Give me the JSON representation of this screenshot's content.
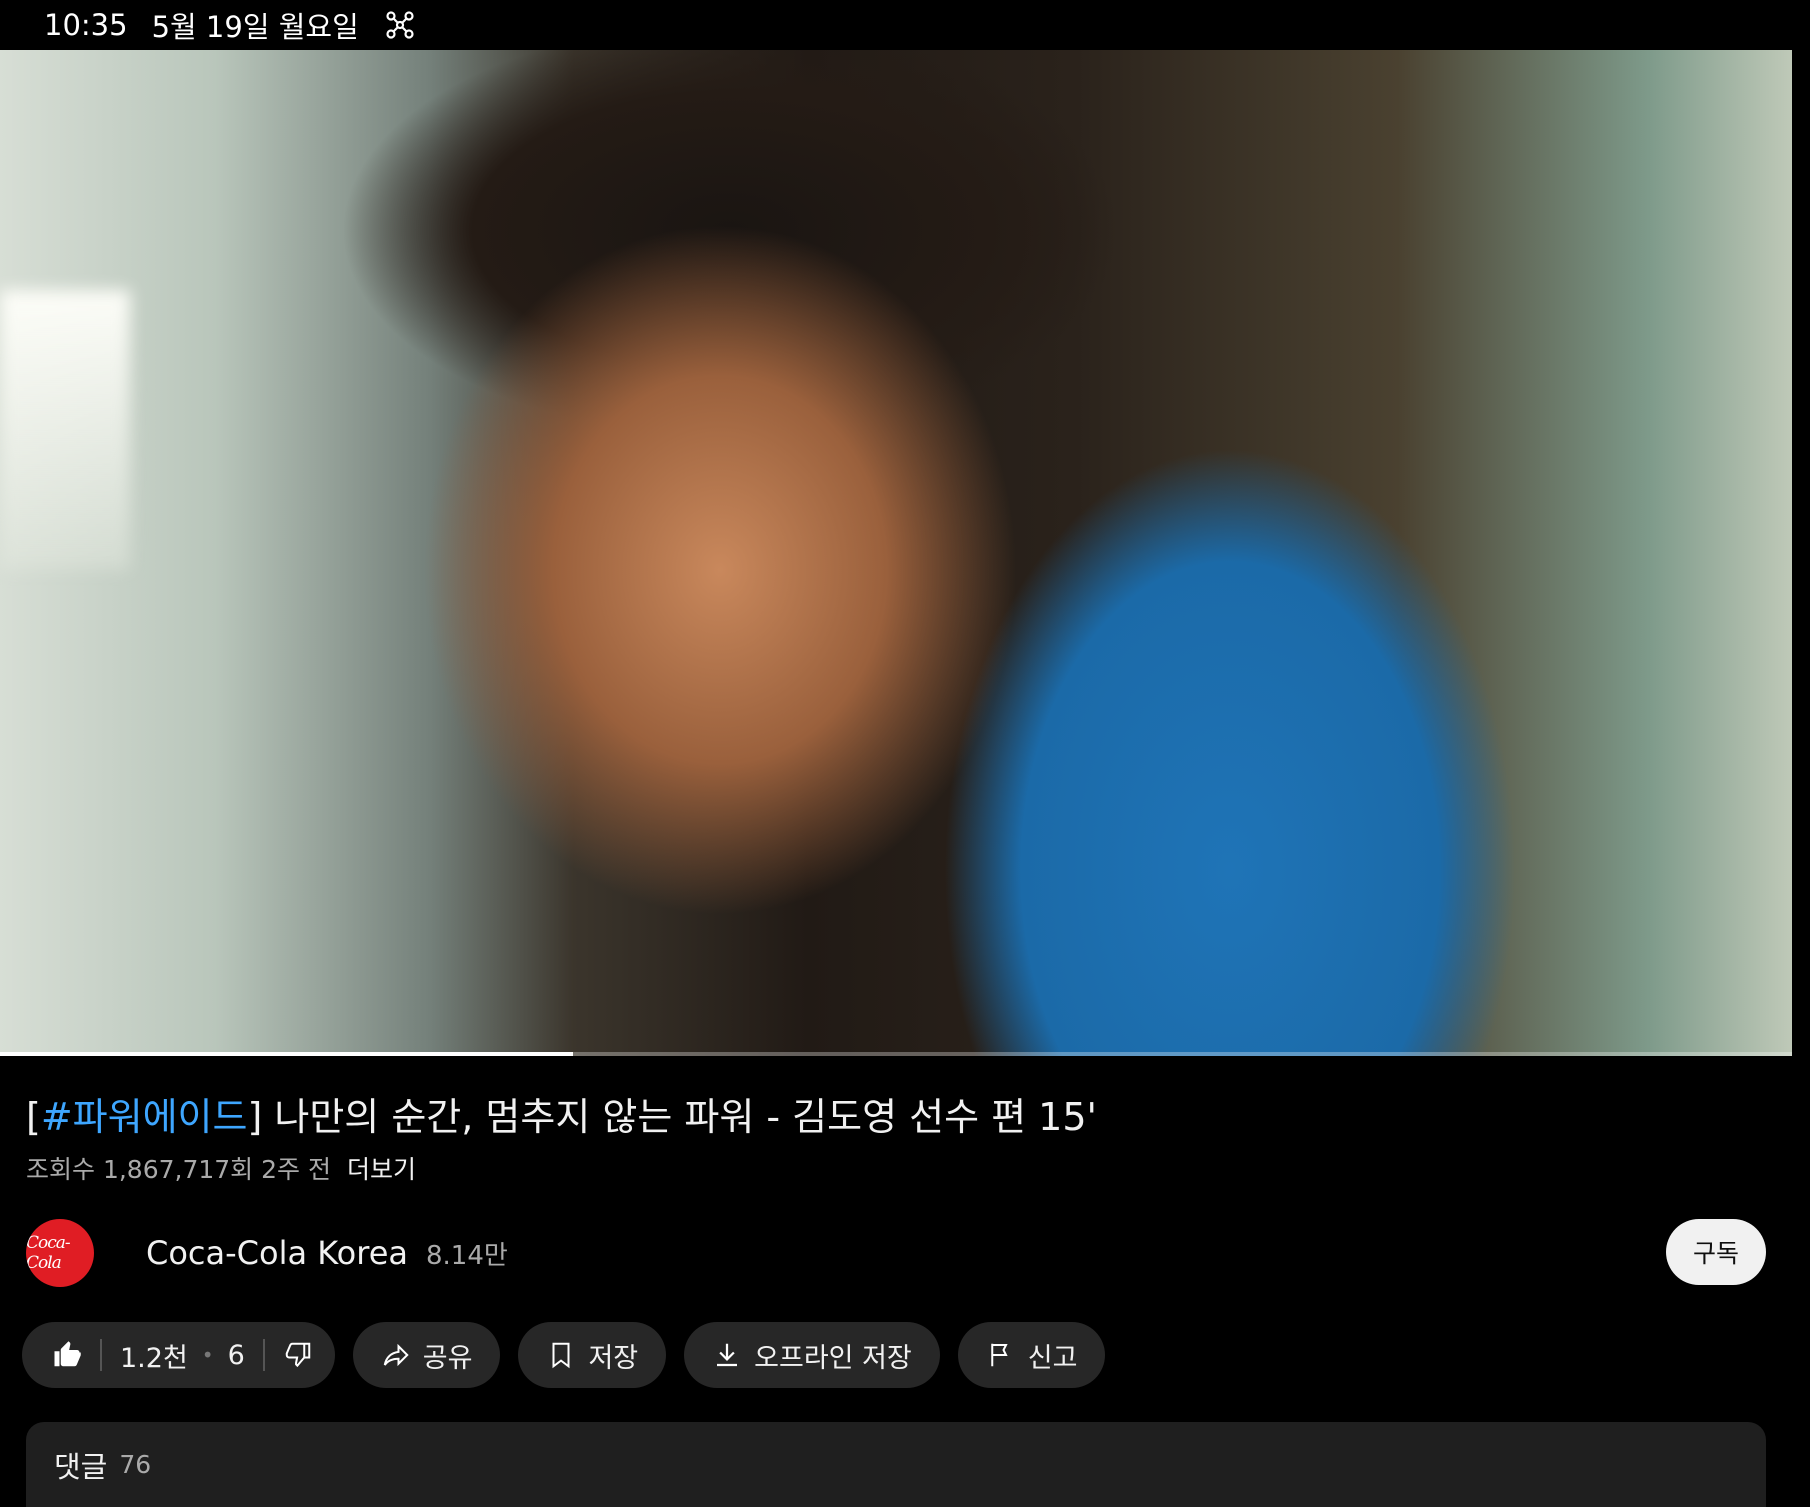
{
  "status_bar": {
    "time": "10:35",
    "date": "5월 19일 월요일",
    "icon": "network-icon"
  },
  "video": {
    "progress_fraction": 0.32
  },
  "title": {
    "bracket_open": "[",
    "hashtag": "#파워에이드",
    "bracket_close": "]",
    "text": " 나만의 순간, 멈추지 않는 파워 - 김도영 선수 편 15'"
  },
  "meta": {
    "views": "조회수 1,867,717회",
    "age": "2주 전",
    "more": "더보기"
  },
  "channel": {
    "avatar_text": "Coca-Cola",
    "name": "Coca-Cola Korea",
    "subscribers": "8.14만",
    "subscribe_label": "구독"
  },
  "actions": {
    "likes": "1.2천",
    "dislikes": "6",
    "share": "공유",
    "save": "저장",
    "download": "오프라인 저장",
    "report": "신고"
  },
  "comments": {
    "label": "댓글",
    "count": "76"
  },
  "colors": {
    "accent_link": "#3ea6ff",
    "pill_bg": "#272727",
    "brand_red": "#e01d24"
  }
}
